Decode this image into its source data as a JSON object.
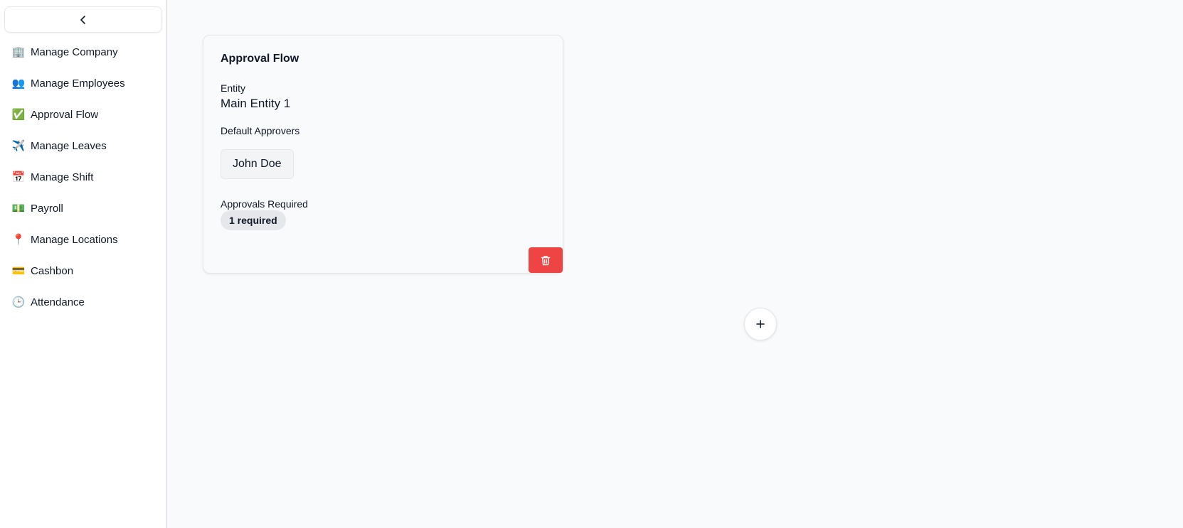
{
  "sidebar": {
    "collapse_icon": "chevron-left-icon",
    "items": [
      {
        "label": "Manage Company",
        "icon": "🏢",
        "icon_name": "office-building-icon"
      },
      {
        "label": "Manage Employees",
        "icon": "👥",
        "icon_name": "people-icon"
      },
      {
        "label": "Approval Flow",
        "icon": "✅",
        "icon_name": "check-mark-icon"
      },
      {
        "label": "Manage Leaves",
        "icon": "✈️",
        "icon_name": "airplane-icon"
      },
      {
        "label": "Manage Shift",
        "icon": "📅",
        "icon_name": "calendar-icon"
      },
      {
        "label": "Payroll",
        "icon": "💵",
        "icon_name": "money-icon"
      },
      {
        "label": "Manage Locations",
        "icon": "📍",
        "icon_name": "location-pin-icon"
      },
      {
        "label": "Cashbon",
        "icon": "💳",
        "icon_name": "credit-card-icon"
      },
      {
        "label": "Attendance",
        "icon": "🕒",
        "icon_name": "clock-icon"
      }
    ]
  },
  "card": {
    "title": "Approval Flow",
    "entity_label": "Entity",
    "entity_value": "Main Entity 1",
    "approvers_label": "Default Approvers",
    "approvers": [
      "John Doe"
    ],
    "approvals_label": "Approvals Required",
    "approvals_badge": "1 required",
    "delete_icon": "trash-icon"
  },
  "add_button": {
    "icon": "plus-icon"
  },
  "colors": {
    "danger": "#ef4444",
    "background": "#f9fafb",
    "sidebar_bg": "#ffffff",
    "badge_bg": "#e5e7eb"
  }
}
